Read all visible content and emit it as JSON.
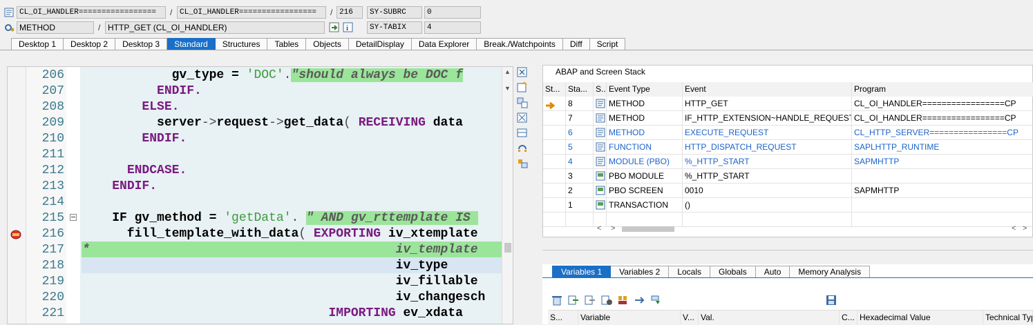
{
  "header": {
    "row1": {
      "program_field": "CL_OI_HANDLER=================",
      "include_field": "CL_OI_HANDLER=================",
      "line_field": "216",
      "sy_label": "SY-SUBRC",
      "sy_value": "0"
    },
    "row2": {
      "type_field": "METHOD",
      "name_field": "HTTP_GET (CL_OI_HANDLER)",
      "sy_label": "SY-TABIX",
      "sy_value": "4"
    },
    "separator": "/"
  },
  "tabs": [
    {
      "label": "Desktop 1",
      "active": false
    },
    {
      "label": "Desktop 2",
      "active": false
    },
    {
      "label": "Desktop 3",
      "active": false
    },
    {
      "label": "Standard",
      "active": true
    },
    {
      "label": "Structures",
      "active": false
    },
    {
      "label": "Tables",
      "active": false
    },
    {
      "label": "Objects",
      "active": false
    },
    {
      "label": "DetailDisplay",
      "active": false
    },
    {
      "label": "Data Explorer",
      "active": false
    },
    {
      "label": "Break./Watchpoints",
      "active": false
    },
    {
      "label": "Diff",
      "active": false
    },
    {
      "label": "Script",
      "active": false
    }
  ],
  "code_lines": [
    {
      "num": "206",
      "html": "            gv_type = <span class='str'>'DOC'</span><span class='op'>.</span><span class='cmt'>\"should always be DOC f</span>"
    },
    {
      "num": "207",
      "html": "          <span class='kw'>ENDIF</span><span class='kw'>.</span>"
    },
    {
      "num": "208",
      "html": "        <span class='kw'>ELSE</span><span class='kw'>.</span>"
    },
    {
      "num": "209",
      "html": "          server<span class='op'>-&gt;</span>request<span class='op'>-&gt;</span>get_data<span class='op'>( </span><span class='kw'>RECEIVING</span> data"
    },
    {
      "num": "210",
      "html": "        <span class='kw'>ENDIF</span><span class='kw'>.</span>"
    },
    {
      "num": "211",
      "html": ""
    },
    {
      "num": "212",
      "html": "      <span class='kw'>ENDCASE</span><span class='kw'>.</span>"
    },
    {
      "num": "213",
      "html": "    <span class='kw'>ENDIF</span><span class='kw'>.</span>"
    },
    {
      "num": "214",
      "html": ""
    },
    {
      "num": "215",
      "html": "    IF gv_method = <span class='str'>'getData'</span><span class='op'>.</span> <span class='cmt'>\" AND gv_rttemplate IS </span>"
    },
    {
      "num": "216",
      "html": "      fill_template_with_data<span class='op'>( </span><span class='kw'>EXPORTING</span> iv_xtemplate"
    },
    {
      "num": "217",
      "html": "<span class='cmt'>*                                         iv_template</span>"
    },
    {
      "num": "218",
      "html": "                                          iv_type"
    },
    {
      "num": "219",
      "html": "                                          iv_fillable"
    },
    {
      "num": "220",
      "html": "                                          iv_changesch"
    },
    {
      "num": "221",
      "html": "                                 <span class='kw'>IMPORTING</span> ev_xdata"
    }
  ],
  "stack": {
    "title": "ABAP and Screen Stack",
    "columns": [
      "St...",
      "Sta...",
      "S...",
      "Event Type",
      "Event",
      "Program"
    ],
    "rows": [
      {
        "level": "8",
        "type": "METHOD",
        "event": "HTTP_GET",
        "program": "CL_OI_HANDLER=================CP",
        "blue": false,
        "current": true
      },
      {
        "level": "7",
        "type": "METHOD",
        "event": "IF_HTTP_EXTENSION~HANDLE_REQUEST",
        "program": "CL_OI_HANDLER=================CP",
        "blue": false,
        "current": false
      },
      {
        "level": "6",
        "type": "METHOD",
        "event": "EXECUTE_REQUEST",
        "program": "CL_HTTP_SERVER================CP",
        "blue": true,
        "current": false
      },
      {
        "level": "5",
        "type": "FUNCTION",
        "event": "HTTP_DISPATCH_REQUEST",
        "program": "SAPLHTTP_RUNTIME",
        "blue": true,
        "current": false
      },
      {
        "level": "4",
        "type": "MODULE (PBO)",
        "event": "%_HTTP_START",
        "program": "SAPMHTTP",
        "blue": true,
        "current": false
      },
      {
        "level": "3",
        "type": "PBO MODULE",
        "event": "%_HTTP_START",
        "program": "",
        "blue": false,
        "current": false
      },
      {
        "level": "2",
        "type": "PBO SCREEN",
        "event": "0010",
        "program": "SAPMHTTP",
        "blue": false,
        "current": false
      },
      {
        "level": "1",
        "type": "TRANSACTION",
        "event": "()",
        "program": "",
        "blue": false,
        "current": false
      }
    ]
  },
  "var_tabs": [
    {
      "label": "Variables 1",
      "active": true
    },
    {
      "label": "Variables 2",
      "active": false
    },
    {
      "label": "Locals",
      "active": false
    },
    {
      "label": "Globals",
      "active": false
    },
    {
      "label": "Auto",
      "active": false
    },
    {
      "label": "Memory Analysis",
      "active": false
    }
  ],
  "var_columns": [
    "S...",
    "Variable",
    "V...",
    "Val.",
    "C...",
    "Hexadecimal Value",
    "Technical Type"
  ],
  "colors": {
    "accent": "#1a6fc6",
    "keyword": "#7a1a82",
    "string": "#3d9b3d",
    "comment_bg": "#9be59b",
    "link": "#1c63c9"
  }
}
